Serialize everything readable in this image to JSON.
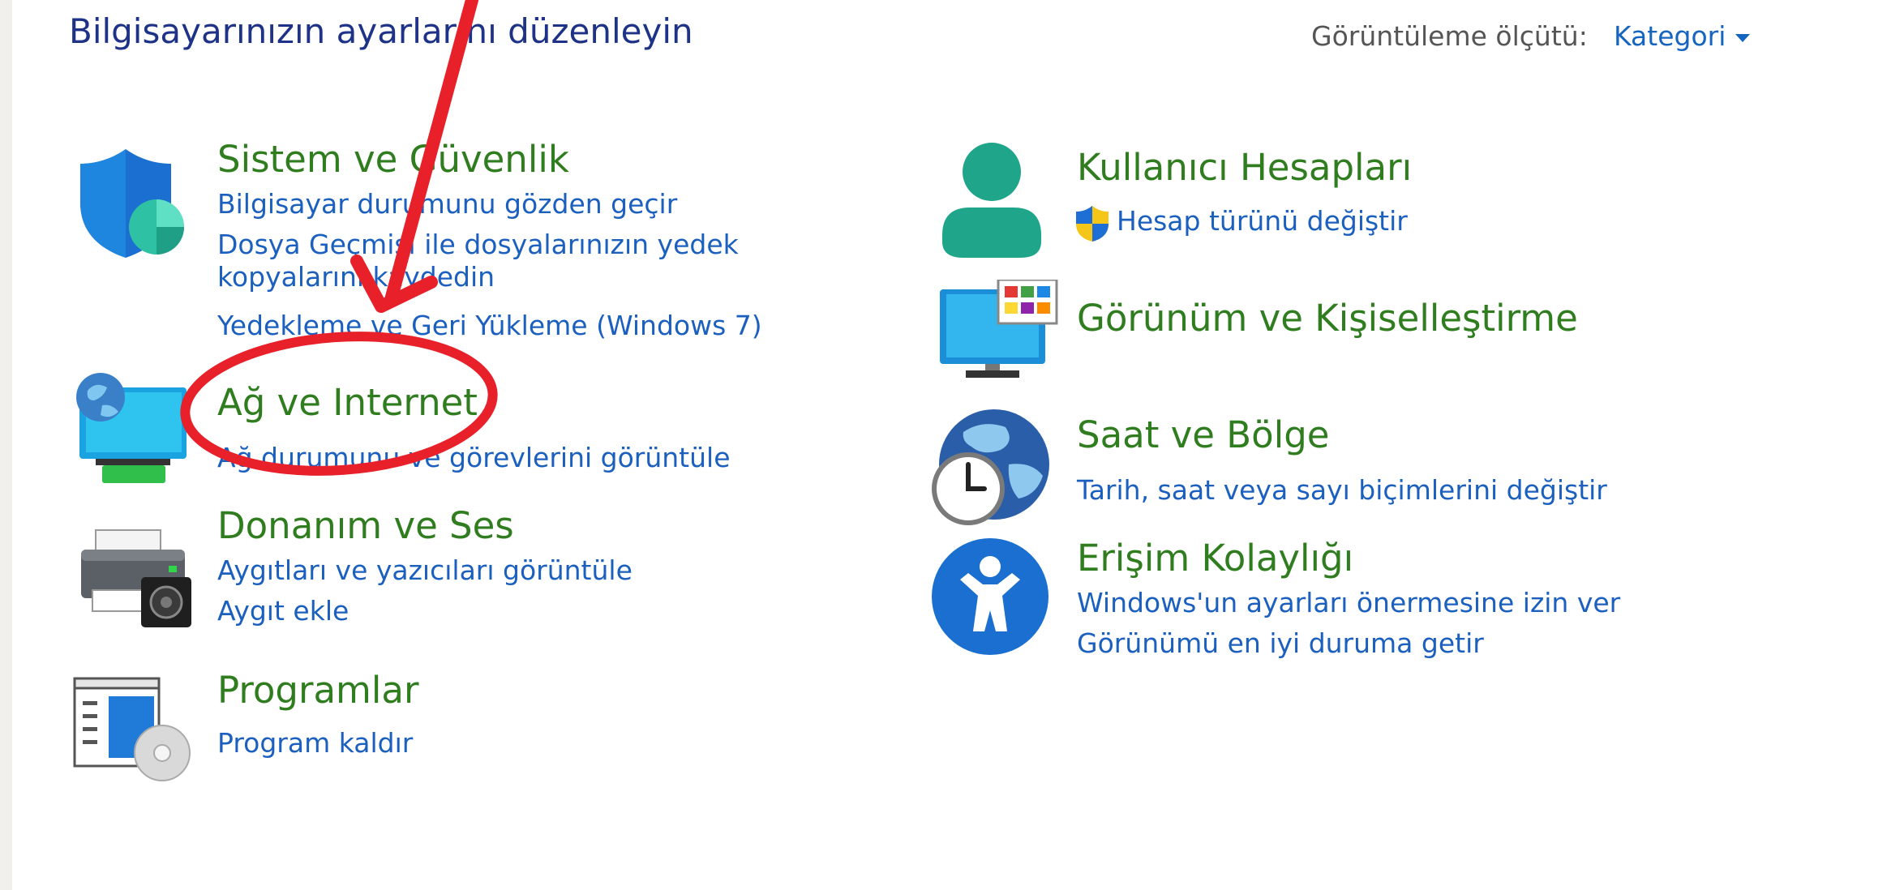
{
  "header": {
    "title": "Bilgisayarınızın ayarlarını düzenleyin",
    "view_by_label": "Görüntüleme ölçütü:",
    "view_by_value": "Kategori"
  },
  "categories": {
    "system_security": {
      "title": "Sistem ve Güvenlik",
      "links": [
        "Bilgisayar durumunu gözden geçir",
        "Dosya Geçmişi ile dosyalarınızın yedek kopyalarını kaydedin",
        "Yedekleme ve Geri Yükleme (Windows 7)"
      ]
    },
    "network_internet": {
      "title": "Ağ ve Internet",
      "links": [
        "Ağ durumunu ve görevlerini görüntüle"
      ]
    },
    "hardware_sound": {
      "title": "Donanım ve Ses",
      "links": [
        "Aygıtları ve yazıcıları görüntüle",
        "Aygıt ekle"
      ]
    },
    "programs": {
      "title": "Programlar",
      "links": [
        "Program kaldır"
      ]
    },
    "user_accounts": {
      "title": "Kullanıcı Hesapları",
      "links": [
        "Hesap türünü değiştir"
      ]
    },
    "appearance": {
      "title": "Görünüm ve Kişiselleştirme",
      "links": []
    },
    "clock_region": {
      "title": "Saat ve Bölge",
      "links": [
        "Tarih, saat veya sayı biçimlerini değiştir"
      ]
    },
    "ease_of_access": {
      "title": "Erişim Kolaylığı",
      "links": [
        "Windows'un ayarları önermesine izin ver",
        "Görünümü en iyi duruma getir"
      ]
    }
  },
  "colors": {
    "title": "#1e3287",
    "category": "#2f7d1f",
    "link": "#1b5fbf",
    "annotation": "#e8202a"
  },
  "icons": [
    "shield-icon",
    "network-computer-icon",
    "printer-speaker-icon",
    "programs-disc-icon",
    "user-icon",
    "monitor-palette-icon",
    "clock-globe-icon",
    "accessibility-icon",
    "uac-shield-icon"
  ]
}
